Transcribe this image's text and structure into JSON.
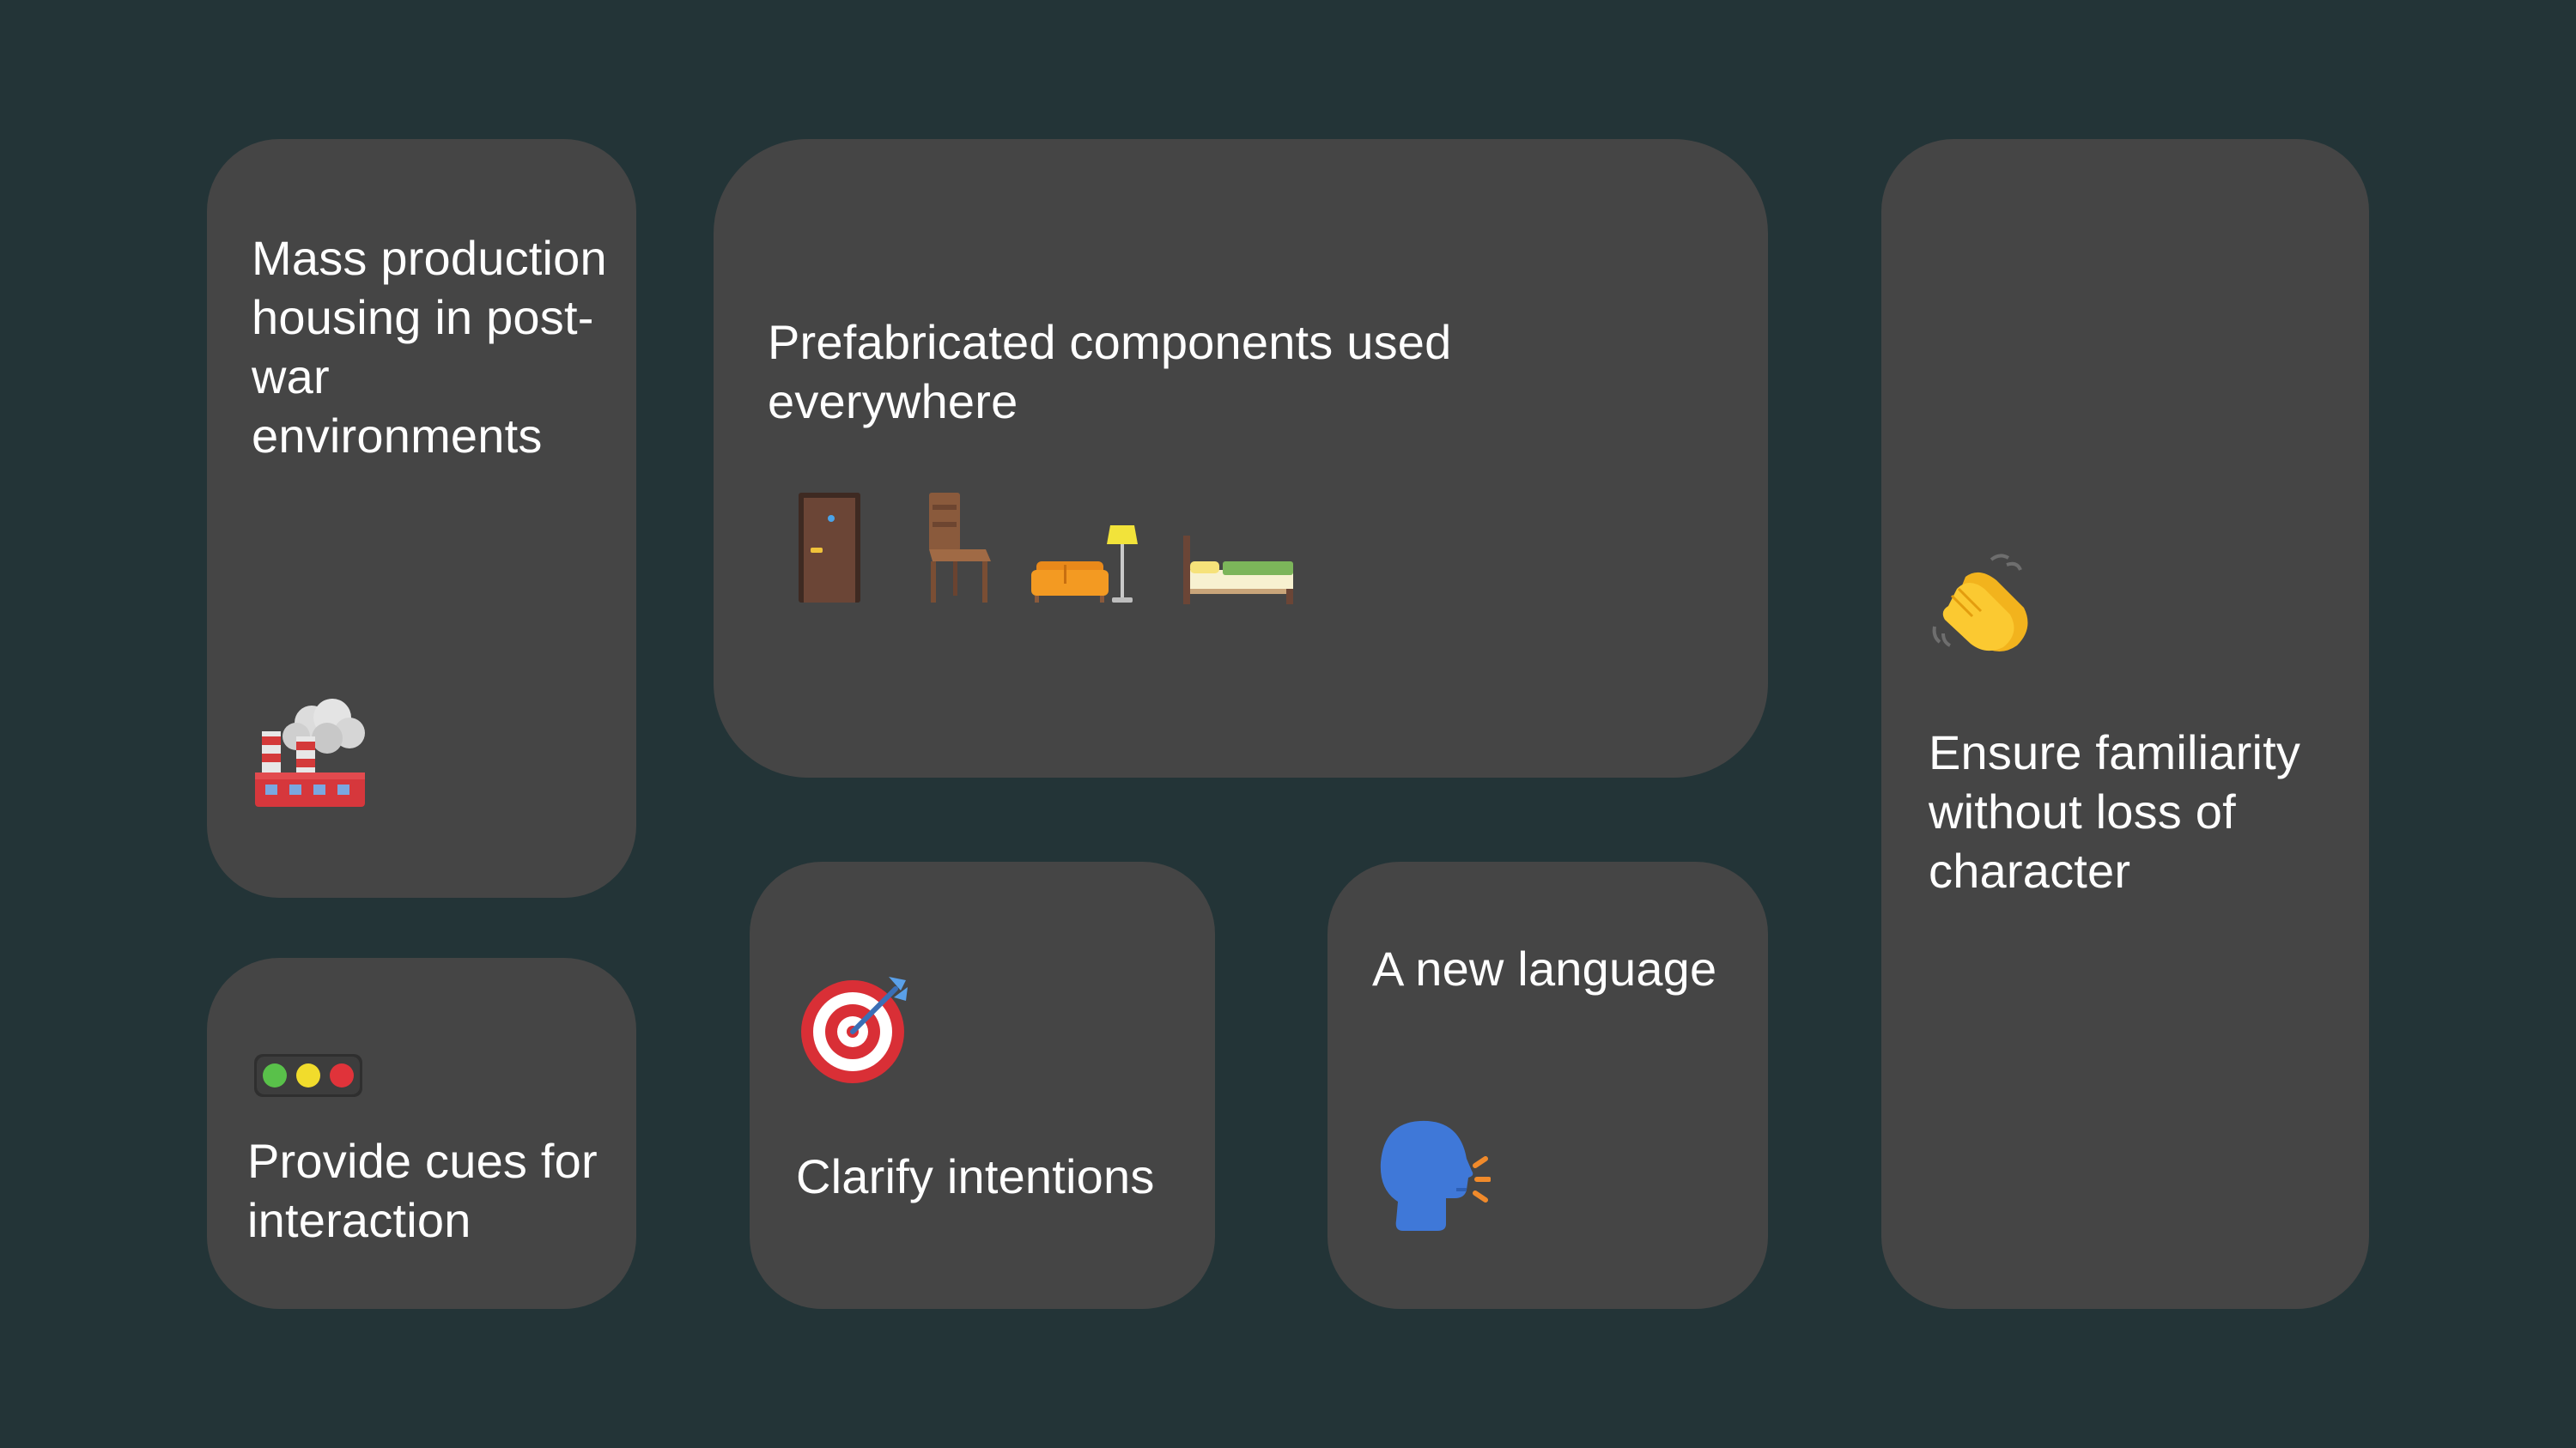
{
  "background_color": "#233437",
  "card_color": "#454545",
  "cards": {
    "mass": {
      "text": "Mass production housing in post-war environments",
      "icon": "factory-icon"
    },
    "prefab": {
      "text": "Prefabricated components used everywhere",
      "icons": [
        "door-icon",
        "chair-icon",
        "couch-and-lamp-icon",
        "bed-icon"
      ]
    },
    "familiar": {
      "text": "Ensure familiarity without loss of character",
      "icon": "clapping-hands-icon"
    },
    "cues": {
      "text": "Provide cues for interaction",
      "icon": "traffic-light-icon"
    },
    "clarify": {
      "text": "Clarify intentions",
      "icon": "direct-hit-icon"
    },
    "language": {
      "text": "A new language",
      "icon": "speaking-head-icon"
    }
  }
}
